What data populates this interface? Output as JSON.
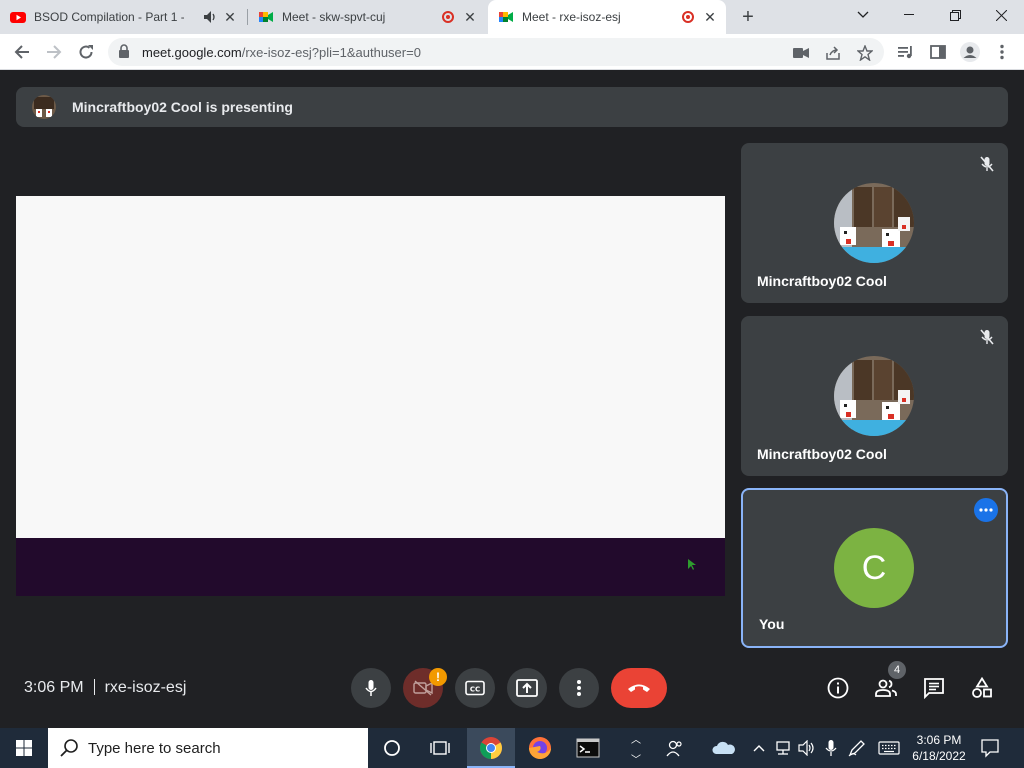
{
  "browser": {
    "tabs": [
      {
        "title": "BSOD Compilation - Part 1 -",
        "favicon": "youtube-icon",
        "audio": true
      },
      {
        "title": "Meet - skw-spvt-cuj",
        "favicon": "google-meet-icon",
        "recording": true
      },
      {
        "title": "Meet - rxe-isoz-esj",
        "favicon": "google-meet-icon",
        "recording": true,
        "active": true
      }
    ],
    "new_tab_label": "+",
    "url_host": "meet.google.com",
    "url_path": "/rxe-isoz-esj?pli=1&authuser=0"
  },
  "meet": {
    "presenting_text": "Mincraftboy02 Cool is presenting",
    "participants": [
      {
        "name": "Mincraftboy02 Cool",
        "muted": true
      },
      {
        "name": "Mincraftboy02 Cool",
        "muted": true
      },
      {
        "name": "You",
        "initial": "C",
        "avatar_color": "#7cb342"
      }
    ],
    "time": "3:06 PM",
    "meeting_code": "rxe-isoz-esj",
    "camera_warning_badge": "!",
    "people_count": "4",
    "colors": {
      "accent": "#8ab4f8",
      "hangup": "#ea4335",
      "tile": "#3c4043",
      "background": "#202124"
    }
  },
  "taskbar": {
    "search_placeholder": "Type here to search",
    "time": "3:06 PM",
    "date": "6/18/2022"
  }
}
